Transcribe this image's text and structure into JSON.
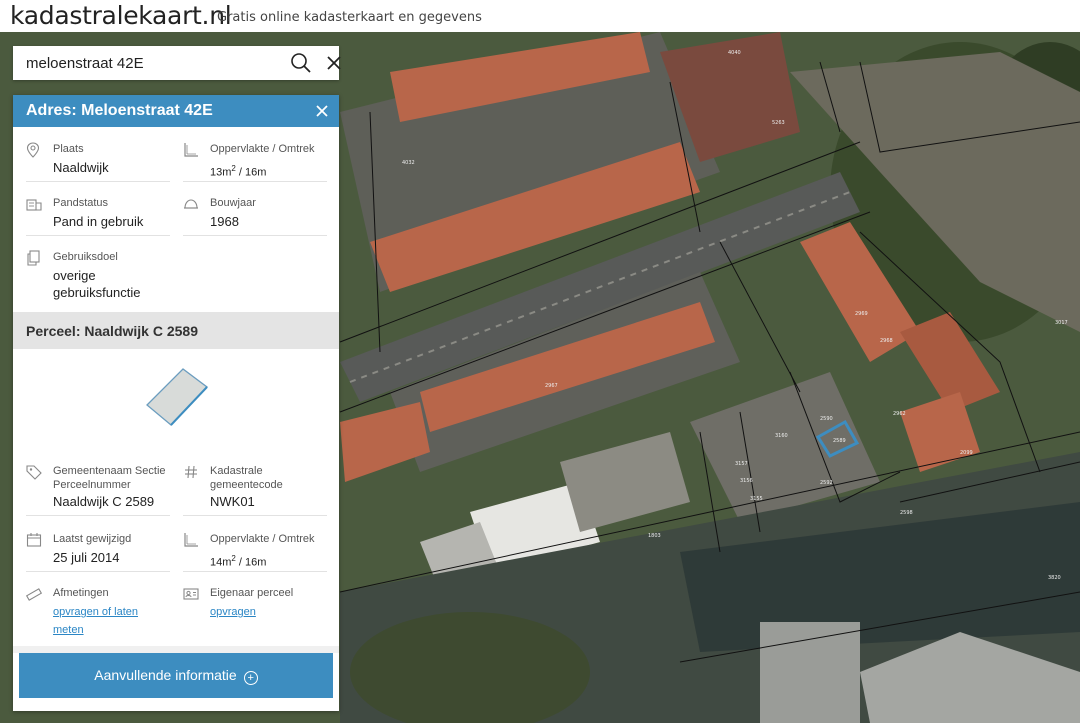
{
  "header": {
    "logo": "kadastralekaart.nl",
    "tagline": "Gratis online kadasterkaart en gegevens"
  },
  "search": {
    "value": "meloenstraat 42E",
    "placeholder": ""
  },
  "panel": {
    "title": "Adres: Meloenstraat 42E",
    "address": {
      "plaats_label": "Plaats",
      "plaats_value": "Naaldwijk",
      "opp_label": "Oppervlakte / Omtrek",
      "opp_area": "13m",
      "opp_sup": "2",
      "opp_perimeter": " / 16m",
      "pandstatus_label": "Pandstatus",
      "pandstatus_value": "Pand in gebruik",
      "bouwjaar_label": "Bouwjaar",
      "bouwjaar_value": "1968",
      "gebruiksdoel_label": "Gebruiksdoel",
      "gebruiksdoel_value_1": "overige",
      "gebruiksdoel_value_2": "gebruiksfunctie"
    },
    "perceel_title": "Perceel: Naaldwijk C 2589",
    "perceel": {
      "gemeente_label_1": "Gemeentenaam Sectie",
      "gemeente_label_2": "Perceelnummer",
      "gemeente_value": "Naaldwijk C 2589",
      "code_label_1": "Kadastrale",
      "code_label_2": "gemeentecode",
      "code_value": "NWK01",
      "gewijzigd_label": "Laatst gewijzigd",
      "gewijzigd_value": "25 juli 2014",
      "opp_label": "Oppervlakte / Omtrek",
      "opp_area": "14m",
      "opp_sup": "2",
      "opp_perimeter": " / 16m",
      "afmetingen_label": "Afmetingen",
      "afmetingen_link_1": "opvragen of laten",
      "afmetingen_link_2": "meten",
      "eigenaar_label": "Eigenaar perceel",
      "eigenaar_link": "opvragen"
    },
    "more_button": "Aanvullende informatie",
    "more_icon": "+"
  },
  "map": {
    "parcel_labels": [
      "2967",
      "2589",
      "3160",
      "2968",
      "2969",
      "2592",
      "3157",
      "3156",
      "3155",
      "2590",
      "2598",
      "3017",
      "3820",
      "1803",
      "4040",
      "5263",
      "4032",
      "2962",
      "2099"
    ]
  },
  "colors": {
    "accent": "#3d8dc0",
    "link": "#2b86c5"
  }
}
